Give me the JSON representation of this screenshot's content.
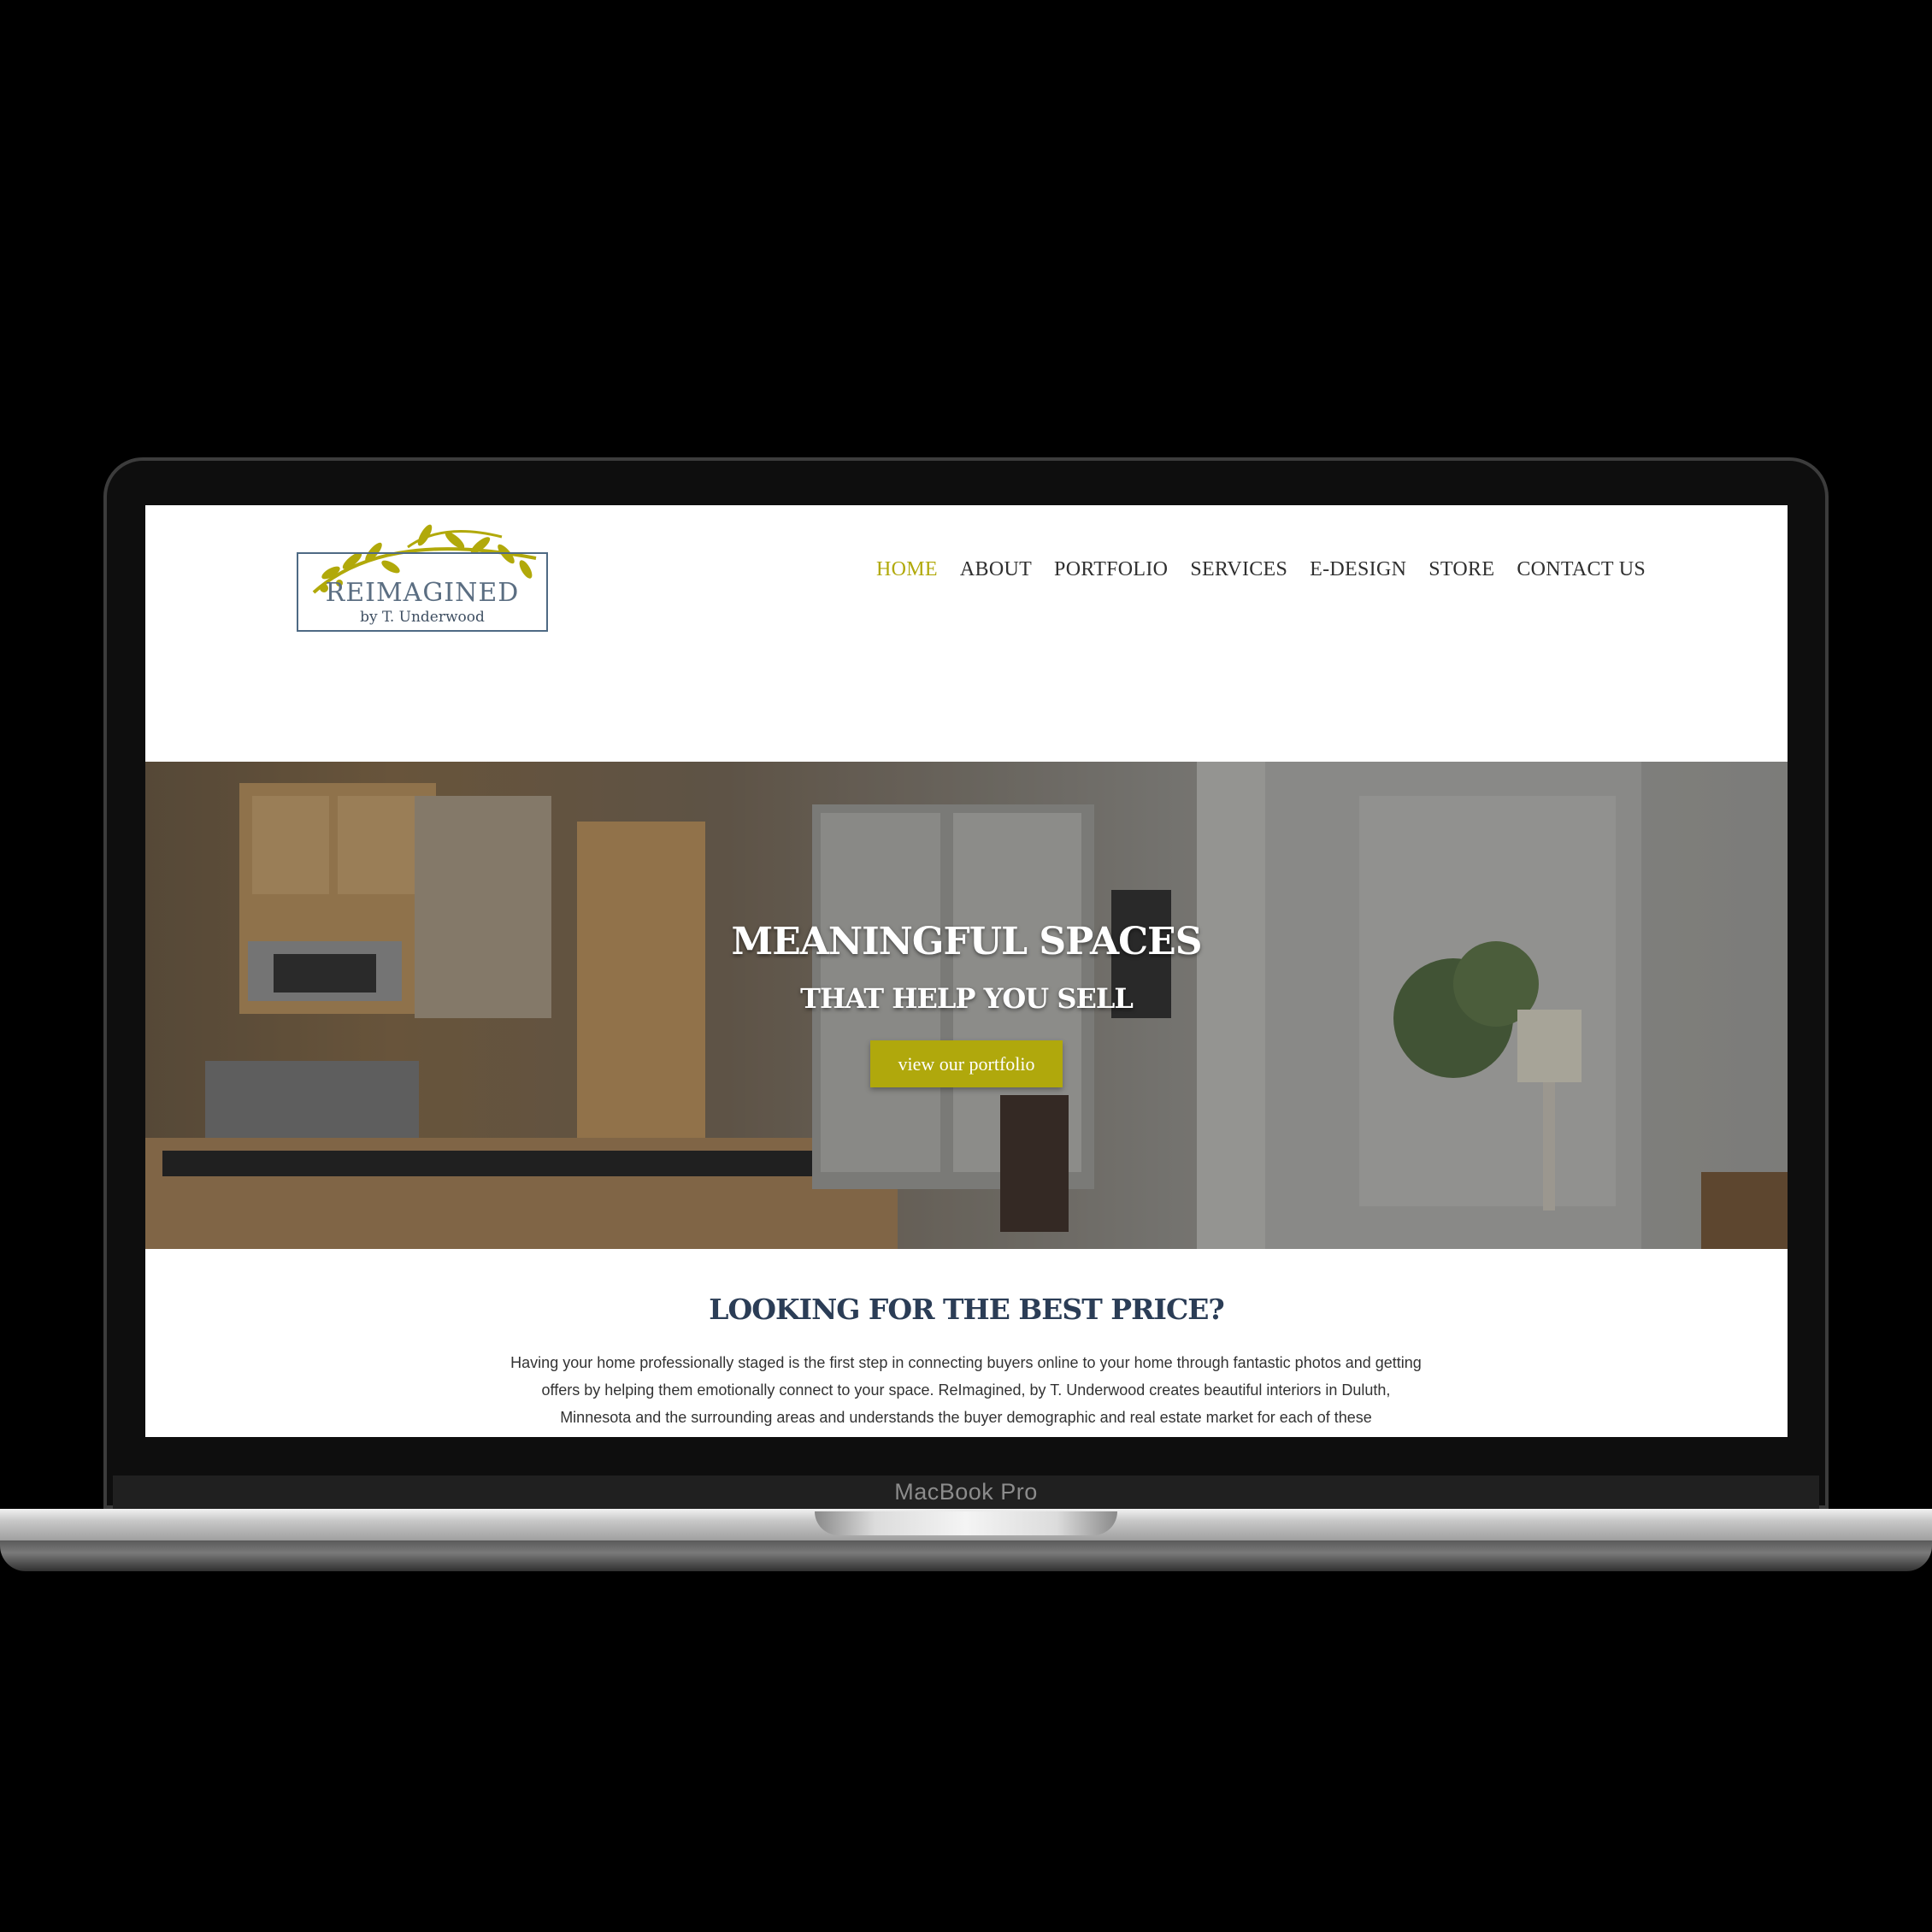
{
  "device": {
    "model_label": "MacBook Pro"
  },
  "logo": {
    "title": "REIMAGINED",
    "subtitle": "by T. Underwood"
  },
  "nav": {
    "items": [
      {
        "label": "HOME",
        "active": true
      },
      {
        "label": "ABOUT"
      },
      {
        "label": "PORTFOLIO"
      },
      {
        "label": "SERVICES"
      },
      {
        "label": "E-DESIGN"
      },
      {
        "label": "STORE"
      },
      {
        "label": "CONTACT US"
      }
    ]
  },
  "hero": {
    "title": "MEANINGFUL SPACES",
    "subtitle": "THAT HELP YOU SELL",
    "button_label": "view our portfolio"
  },
  "section": {
    "title": "LOOKING FOR THE BEST PRICE?",
    "body": "Having your home professionally staged is the first step in connecting buyers online to your home through fantastic photos and getting offers by helping them emotionally connect to your space. ReImagined, by T. Underwood creates beautiful interiors in Duluth, Minnesota and the surrounding areas and understands the buyer demographic and real estate market for each of these"
  },
  "colors": {
    "accent": "#b1a90a",
    "heading": "#2b3d56",
    "logo_frame": "#4e6a84"
  }
}
